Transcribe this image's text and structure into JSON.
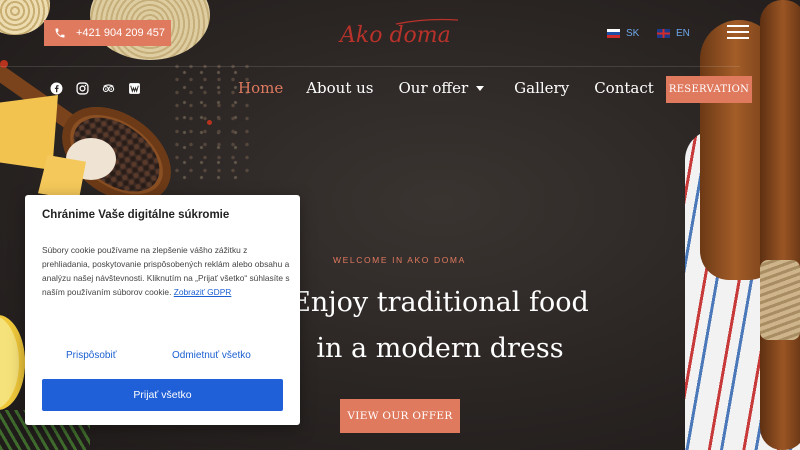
{
  "header": {
    "phone": "+421 904 209 457",
    "logo_text": "Ako doma",
    "languages": [
      {
        "code": "SK",
        "flag": "flag-sk"
      },
      {
        "code": "EN",
        "flag": "flag-en"
      }
    ]
  },
  "social_icons": [
    "facebook-icon",
    "instagram-icon",
    "tripadvisor-icon",
    "website-icon"
  ],
  "nav": {
    "items": [
      {
        "label": "Home",
        "active": true
      },
      {
        "label": "About us",
        "active": false
      },
      {
        "label": "Our offer",
        "active": false,
        "has_dropdown": true
      },
      {
        "label": "Gallery",
        "active": false
      },
      {
        "label": "Contact",
        "active": false
      }
    ],
    "reservation_label": "RESERVATION"
  },
  "hero": {
    "welcome": "WELCOME IN AKO DOMA",
    "title_line1": "Enjoy traditional food",
    "title_line2": "in a modern dress",
    "cta_label": "VIEW OUR OFFER"
  },
  "cookie": {
    "title": "Chránime Vaše digitálne súkromie",
    "body": "Súbory cookie používame na zlepšenie vášho zážitku z prehliadania, poskytovanie prispôsobených reklám alebo obsahu a analýzu našej návštevnosti. Kliknutím na „Prijať všetko“ súhlasíte s naším používaním súborov cookie.",
    "gdpr_link": "Zobraziť GDPR",
    "customize": "Prispôsobiť",
    "reject": "Odmietnuť všetko",
    "accept": "Prijať všetko"
  },
  "colors": {
    "accent": "#e07a5f",
    "primary_blue": "#1f5fd8",
    "background": "#2b2624"
  }
}
